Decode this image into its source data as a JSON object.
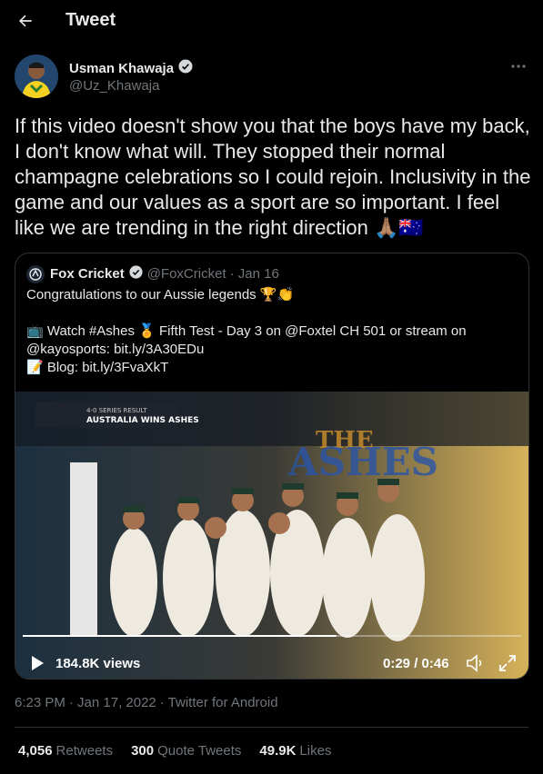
{
  "header": {
    "title": "Tweet",
    "back_icon": "back-arrow-icon"
  },
  "author": {
    "name": "Usman Khawaja",
    "handle": "@Uz_Khawaja",
    "verified": true
  },
  "tweet": {
    "text": "If this video doesn't show you that the boys have my back, I don't know what will. They stopped their normal champagne celebrations so I could rejoin. Inclusivity in the game and our values as a sport are so important. I feel like we are trending in the right direction 🙏🏽🇦🇺"
  },
  "quote": {
    "name": "Fox Cricket",
    "handle": "@FoxCricket",
    "date": "· Jan 16",
    "verified": true,
    "text": "Congratulations to our Aussie legends 🏆👏\n\n📺 Watch #Ashes 🏅 Fifth Test - Day 3 on @Foxtel CH 501 or stream on @kayosports: bit.ly/3A30EDu\n📝 Blog: bit.ly/3FvaXkT",
    "video": {
      "overlay_line1": "4-0 SERIES RESULT",
      "overlay_line2": "AUSTRALIA WINS ASHES",
      "views": "184.8K views",
      "time": "0:29 / 0:46",
      "progress": 0.63
    }
  },
  "meta": {
    "time": "6:23 PM",
    "date": "· Jan 17, 2022",
    "source": "· Twitter for Android"
  },
  "stats": {
    "retweets_count": "4,056",
    "retweets_label": "Retweets",
    "quotes_count": "300",
    "quotes_label": "Quote Tweets",
    "likes_count": "49.9K",
    "likes_label": "Likes"
  },
  "colors": {
    "background": "#000000",
    "text": "#e7e9ea",
    "muted": "#71767b",
    "border": "#2f3336",
    "verified": "#1d9bf0"
  }
}
